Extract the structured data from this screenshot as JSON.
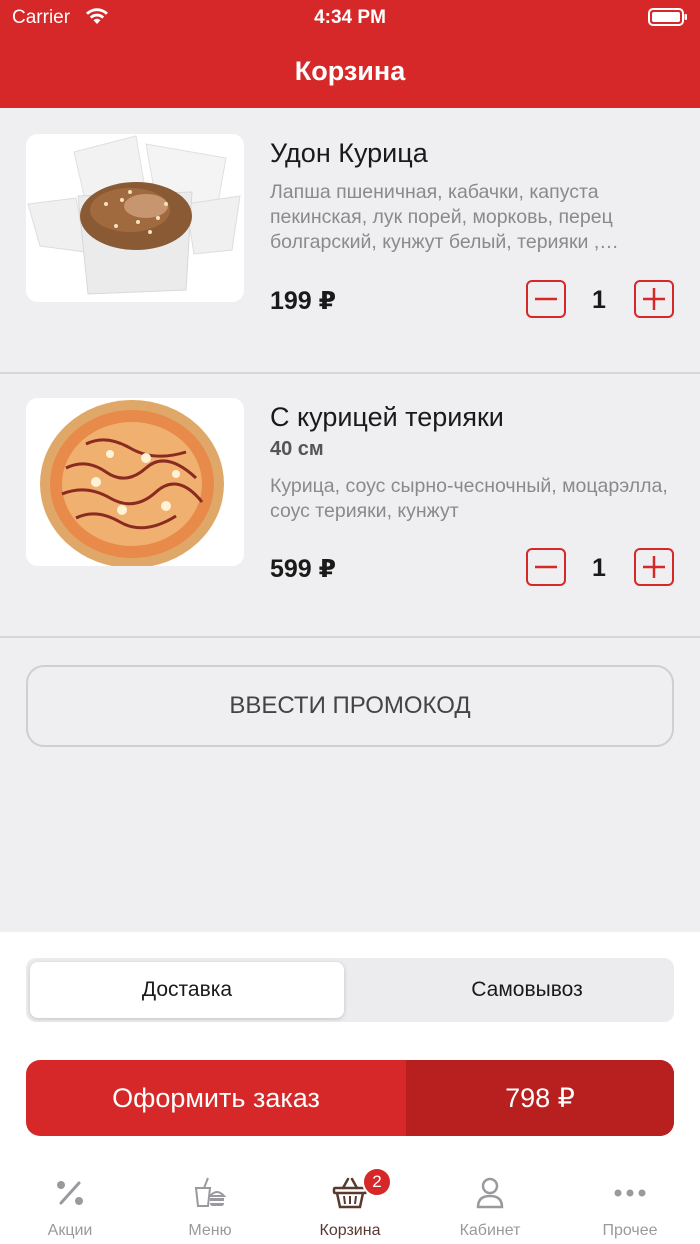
{
  "status_bar": {
    "carrier": "Carrier",
    "time": "4:34 PM"
  },
  "header": {
    "title": "Корзина"
  },
  "cart": {
    "items": [
      {
        "name": "Удон Курица",
        "size": "",
        "description": "Лапша пшеничная, кабачки, капуста пекинская, лук порей, морковь, перец болгарский, кунжут белый, терияки ,…",
        "price": "199 ₽",
        "quantity": "1"
      },
      {
        "name": "С курицей терияки",
        "size": "40 см",
        "description": "Курица, соус сырно-чесночный, моцарэлла, соус терияки, кунжут",
        "price": "599 ₽",
        "quantity": "1"
      }
    ]
  },
  "promo": {
    "label": "ВВЕСТИ ПРОМОКОД"
  },
  "delivery_toggle": {
    "delivery": "Доставка",
    "pickup": "Самовывоз",
    "selected": "delivery"
  },
  "checkout": {
    "label": "Оформить заказ",
    "total": "798 ₽"
  },
  "tabbar": {
    "tabs": [
      {
        "label": "Акции",
        "icon": "percent-icon"
      },
      {
        "label": "Меню",
        "icon": "menu-food-icon"
      },
      {
        "label": "Корзина",
        "icon": "basket-icon"
      },
      {
        "label": "Кабинет",
        "icon": "user-icon"
      },
      {
        "label": "Прочее",
        "icon": "more-icon"
      }
    ],
    "active": "Корзина",
    "cart_badge": "2"
  },
  "colors": {
    "accent": "#d62828",
    "accent_dark": "#b81f1f",
    "background": "#efeff1"
  }
}
